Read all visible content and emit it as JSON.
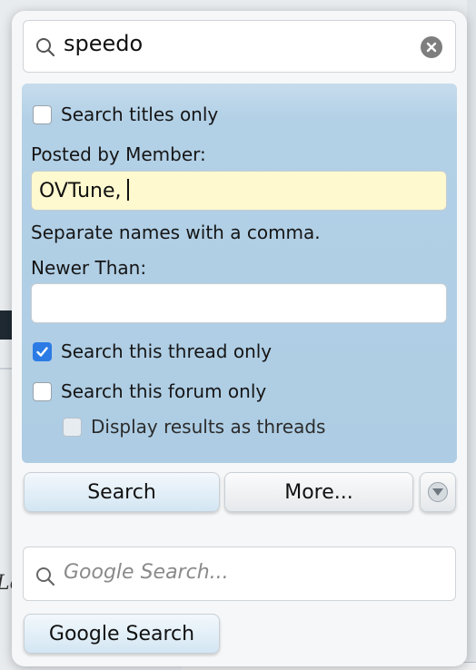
{
  "search": {
    "query": "speedo"
  },
  "options": {
    "titles_only_label": "Search titles only",
    "titles_only_checked": false,
    "posted_by_label": "Posted by Member:",
    "posted_by_value": "OVTune,",
    "separate_hint": "Separate names with a comma.",
    "newer_than_label": "Newer Than:",
    "newer_than_value": "",
    "thread_only_label": "Search this thread only",
    "thread_only_checked": true,
    "forum_only_label": "Search this forum only",
    "forum_only_checked": false,
    "as_threads_label": "Display results as threads",
    "as_threads_checked": false
  },
  "buttons": {
    "search": "Search",
    "more": "More..."
  },
  "google": {
    "placeholder": "Google Search...",
    "button": "Google Search"
  },
  "background": {
    "fragment": "Lo"
  },
  "colors": {
    "accent": "#2c7be5",
    "panel": "#b2d0e6",
    "field_highlight": "#fff9cf"
  }
}
